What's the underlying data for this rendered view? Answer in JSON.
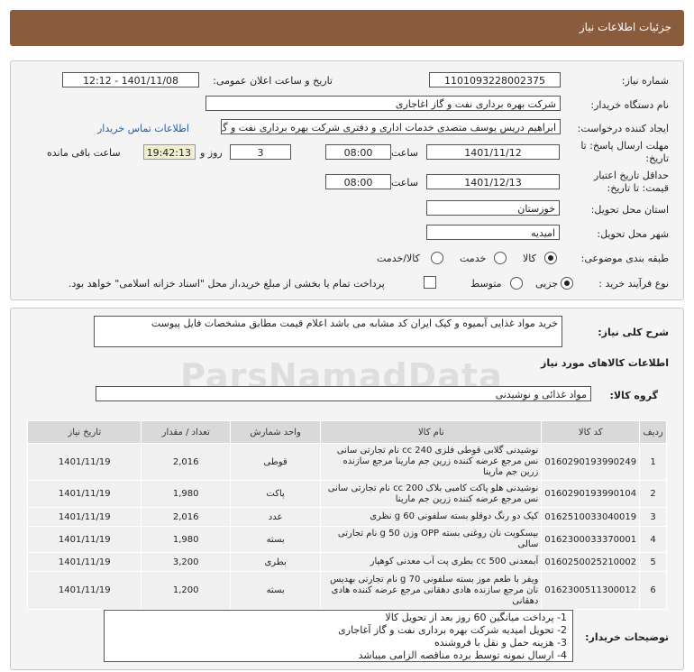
{
  "header": {
    "title": "جزئیات اطلاعات نیاز"
  },
  "form": {
    "need_number_label": "شماره نیاز:",
    "need_number": "1101093228002375",
    "announce_label": "تاریخ و ساعت اعلان عمومی:",
    "announce_value": "1401/11/08 - 12:12",
    "buyer_org_label": "نام دستگاه خریدار:",
    "buyer_org": "شرکت بهره برداری نفت و گاز اغاجاری",
    "requester_label": "ایجاد کننده درخواست:",
    "requester": "ابراهیم دریس یوسف متصدی خدمات اداری و دفتری شرکت بهره برداری نفت و گ",
    "contact_link": "اطلاعات تماس خریدار",
    "reply_deadline_label": "مهلت ارسال پاسخ: تا تاریخ:",
    "reply_date": "1401/11/12",
    "time_label": "ساعت",
    "reply_time": "08:00",
    "days_value": "3",
    "days_label": "روز و",
    "remaining_time": "19:42:13",
    "remaining_label": "ساعت باقی مانده",
    "price_validity_label": "حداقل تاریخ اعتبار قیمت: تا تاریخ:",
    "validity_date": "1401/12/13",
    "validity_time": "08:00",
    "province_label": "استان محل تحویل:",
    "province": "خوزستان",
    "city_label": "شهر محل تحویل:",
    "city": "امیدیه",
    "category_label": "طبقه بندی موضوعی:",
    "category_options": [
      "کالا",
      "خدمت",
      "کالا/خدمت"
    ],
    "purchase_type_label": "نوع فرآیند خرید :",
    "purchase_options": [
      "جزیی",
      "متوسط"
    ],
    "payment_note": "پرداخت تمام یا بخشی از مبلغ خرید،از محل \"اسناد خزانه اسلامی\" خواهد بود."
  },
  "description": {
    "label": "شرح کلی نیاز:",
    "text": "خرید مواد غذایی آبمیوه و کیک ایران کد مشابه می باشد اعلام قیمت مطابق مشخصات  فایل پیوست"
  },
  "goods_section": {
    "title": "اطلاعات کالاهای مورد نیاز",
    "group_label": "گروه کالا:",
    "group_value": "مواد غذائی و نوشیدنی"
  },
  "table": {
    "headers": [
      "ردیف",
      "کد کالا",
      "نام کالا",
      "واحد شمارش",
      "تعداد / مقدار",
      "تاریخ نیاز"
    ],
    "rows": [
      [
        "1",
        "0160290193990249",
        "نوشیدنی گلابی قوطی فلزی 240 cc نام تجارتی سانی نس مرجع عرضه کننده زرین جم مارینا مرجع سازنده زرین جم مارینا",
        "قوطی",
        "2,016",
        "1401/11/19"
      ],
      [
        "2",
        "0160290193990104",
        "نوشیدنی هلو پاکت کامبی بلاک 200 cc نام تجارتی سانی نس مرجع عرضه کننده زرین جم مارینا",
        "پاکت",
        "1,980",
        "1401/11/19"
      ],
      [
        "3",
        "0162510033040019",
        "کیک دو رنگ دوقلو بسته سلفونی 60 g نظری",
        "عدد",
        "2,016",
        "1401/11/19"
      ],
      [
        "4",
        "0162300033370001",
        "بیسکویت نان روغنی بسته OPP وزن 50 g نام تجارتی سالی",
        "بسته",
        "1,980",
        "1401/11/19"
      ],
      [
        "5",
        "0160250025210002",
        "آبمعدنی 500 cc بطری پت آب معدنی کوهپار",
        "بطری",
        "3,200",
        "1401/11/19"
      ],
      [
        "6",
        "0162300511300012",
        "ویفر با طعم موز بسته سلفونی 70 g نام تجارتی بهدیس نان مرجع سازنده هادی دهقانی مرجع عرضه کننده هادی دهقانی",
        "بسته",
        "1,200",
        "1401/11/19"
      ]
    ]
  },
  "buyer_notes": {
    "label": "توضیحات خریدار:",
    "lines": [
      "1- پرداخت میانگین 60 روز بعد از تحویل کالا",
      "2- تحویل امیدیه شرکت بهره برداری نفت و گاز آغاجاری",
      "3- هزینه حمل و نقل با فروشنده",
      "4- ارسال نمونه توسط برده مناقصه الزامی میباشد"
    ]
  },
  "watermark": {
    "text": "ParsNamadData"
  }
}
